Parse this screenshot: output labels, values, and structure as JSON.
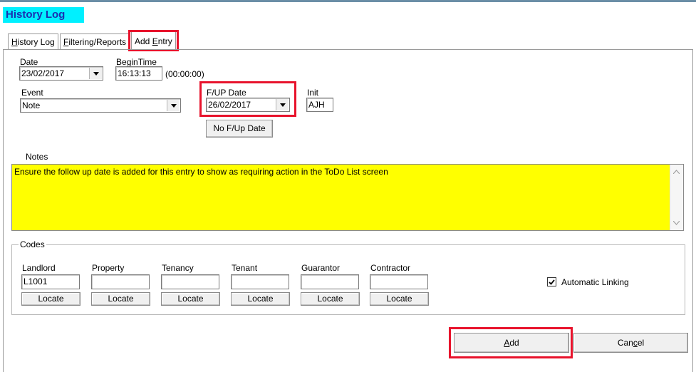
{
  "window": {
    "title": "History Log"
  },
  "tabs": [
    {
      "label_pre": "",
      "label_key": "H",
      "label_post": "istory Log"
    },
    {
      "label_pre": "",
      "label_key": "F",
      "label_post": "iltering/Reports"
    },
    {
      "label_pre": "Add ",
      "label_key": "E",
      "label_post": "ntry"
    }
  ],
  "form": {
    "date": {
      "label": "Date",
      "value": "23/02/2017"
    },
    "begin_time": {
      "label_pre": "Be",
      "label_key": "g",
      "label_post": "inTime",
      "value": "16:13:13",
      "duration": "(00:00:00)"
    },
    "event": {
      "label": "Event",
      "value": "Note"
    },
    "fup_date": {
      "label": "F/UP Date",
      "value": "26/02/2017"
    },
    "init": {
      "label": "Init",
      "value": "AJH"
    },
    "no_fup_button": "No F/Up Date",
    "notes": {
      "label": "Notes",
      "value": "Ensure the follow up date is added for this entry to show as requiring action in the ToDo List screen"
    }
  },
  "codes": {
    "legend": "Codes",
    "fields": [
      {
        "label": "Landlord",
        "value": "L1001",
        "locate": "Locate"
      },
      {
        "label": "Property",
        "value": "",
        "locate": "Locate"
      },
      {
        "label": "Tenancy",
        "value": "",
        "locate": "Locate"
      },
      {
        "label": "Tenant",
        "value": "",
        "locate": "Locate"
      },
      {
        "label": "Guarantor",
        "value": "",
        "locate": "Locate"
      },
      {
        "label": "Contractor",
        "value": "",
        "locate": "Locate"
      }
    ],
    "automatic_linking": {
      "label": "Automatic Linking",
      "checked": true
    }
  },
  "actions": {
    "add": {
      "pre": "",
      "key": "A",
      "post": "dd"
    },
    "cancel": {
      "pre": "Can",
      "key": "c",
      "post": "el"
    }
  },
  "colors": {
    "notes_bg": "#ffff00",
    "title_bg": "#00f0ff",
    "highlight": "#e8132c"
  }
}
